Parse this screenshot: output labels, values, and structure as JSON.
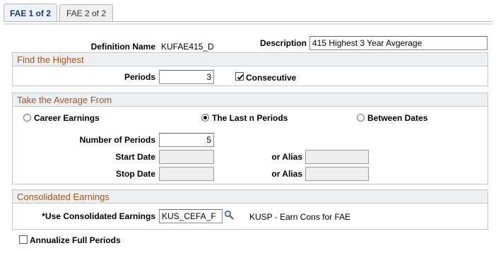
{
  "tabs": [
    {
      "label": "FAE 1 of 2",
      "active": true
    },
    {
      "label": "FAE 2 of 2",
      "active": false
    }
  ],
  "header": {
    "definition_label": "Definition Name",
    "definition_value": "KUFAE415_D",
    "description_label": "Description",
    "description_value": "415 Highest 3 Year Avgerage"
  },
  "find_highest": {
    "title": "Find the Highest",
    "periods_label": "Periods",
    "periods_value": "3",
    "consecutive_label": "Consecutive",
    "consecutive_checked": true
  },
  "average_from": {
    "title": "Take the Average From",
    "options": [
      {
        "label": "Career Earnings",
        "selected": false
      },
      {
        "label": "The Last n Periods",
        "selected": true
      },
      {
        "label": "Between Dates",
        "selected": false
      }
    ],
    "num_periods_label": "Number of Periods",
    "num_periods_value": "5",
    "start_date_label": "Start Date",
    "start_date_value": "",
    "stop_date_label": "Stop Date",
    "stop_date_value": "",
    "alias_label": "or Alias",
    "start_alias_value": "",
    "stop_alias_value": ""
  },
  "consolidated": {
    "title": "Consolidated Earnings",
    "use_label": "*Use Consolidated Earnings",
    "use_value": "KUS_CEFA_F",
    "use_description": "KUSP - Earn Cons for FAE",
    "lookup_icon": "magnifier-icon"
  },
  "annualize": {
    "label": "Annualize Full Periods",
    "checked": false
  },
  "colors": {
    "group_title": "#a4541a",
    "group_header_bg": "#edf0f3",
    "tab_active_text": "#1a3a6b"
  }
}
